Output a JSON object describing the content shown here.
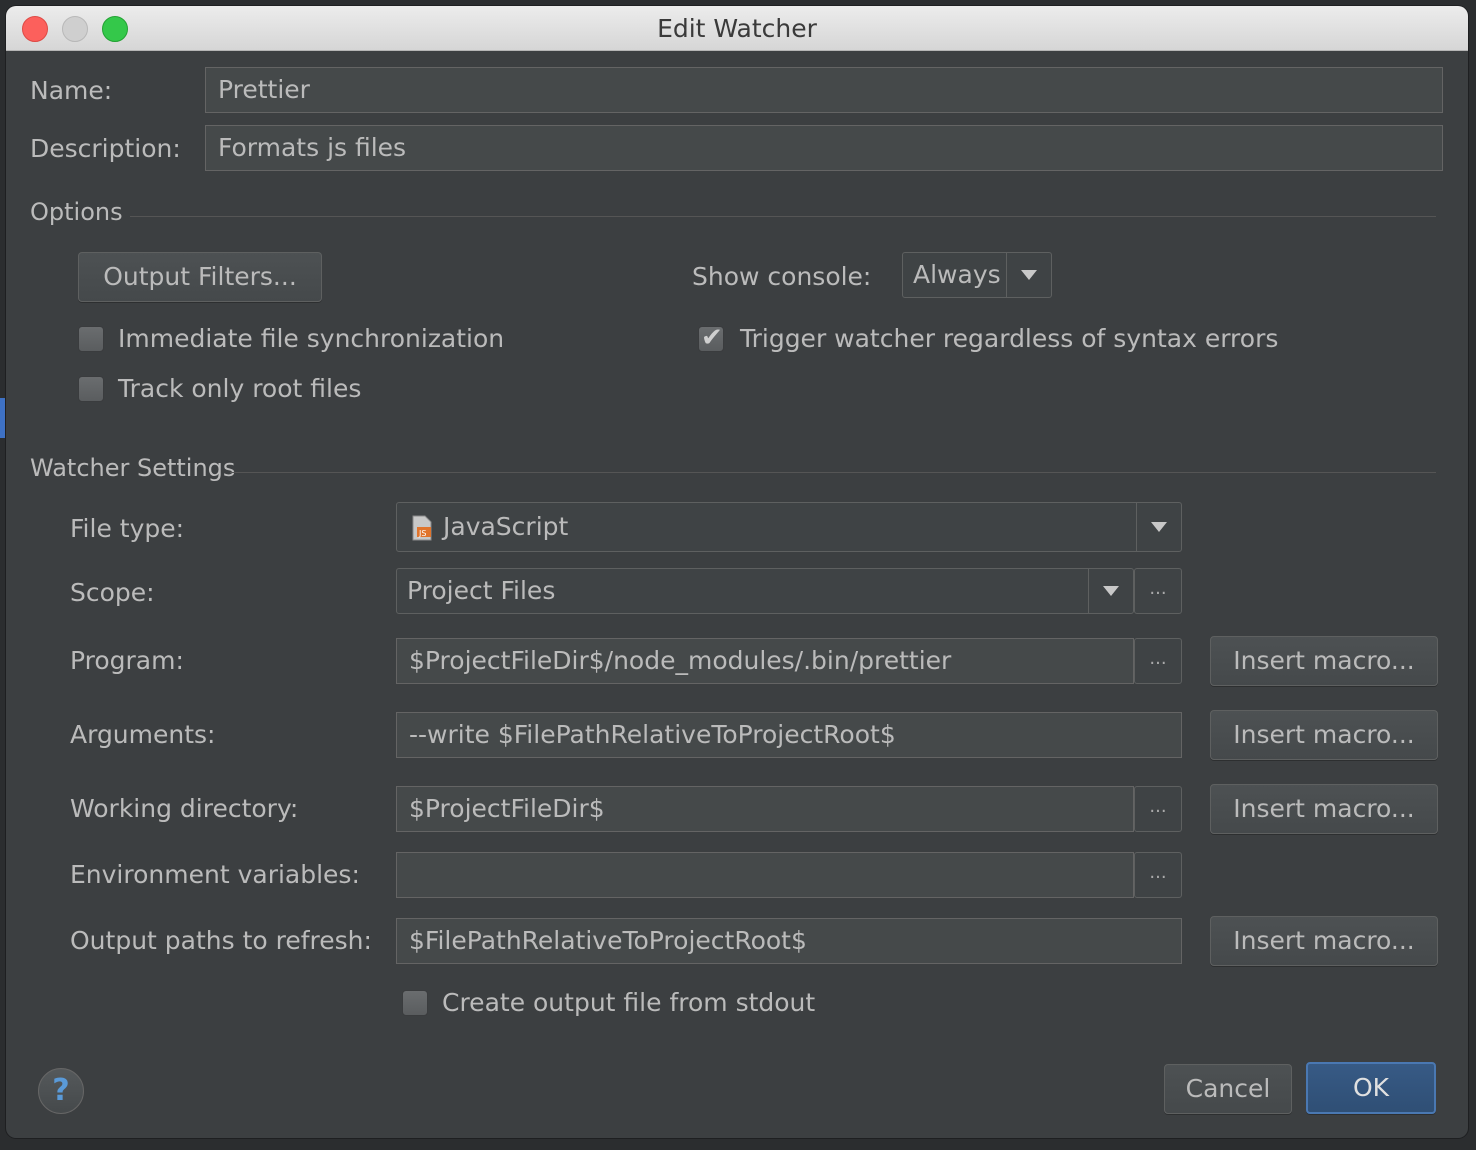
{
  "window": {
    "title": "Edit Watcher"
  },
  "name": {
    "label": "Name:",
    "value": "Prettier"
  },
  "description": {
    "label": "Description:",
    "value": "Formats js files"
  },
  "options": {
    "section_label": "Options",
    "output_filters_button": "Output Filters...",
    "show_console_label": "Show console:",
    "show_console_value": "Always",
    "immediate_sync": {
      "label": "Immediate file synchronization",
      "checked": false
    },
    "track_root": {
      "label": "Track only root files",
      "checked": false
    },
    "trigger_regardless": {
      "label": "Trigger watcher regardless of syntax errors",
      "checked": true
    }
  },
  "watcher": {
    "section_label": "Watcher Settings",
    "file_type": {
      "label": "File type:",
      "value": "JavaScript",
      "icon": "js-file-icon"
    },
    "scope": {
      "label": "Scope:",
      "value": "Project Files"
    },
    "program": {
      "label": "Program:",
      "value": "$ProjectFileDir$/node_modules/.bin/prettier"
    },
    "arguments": {
      "label": "Arguments:",
      "value": "--write $FilePathRelativeToProjectRoot$"
    },
    "working_dir": {
      "label": "Working directory:",
      "value": "$ProjectFileDir$"
    },
    "env_vars": {
      "label": "Environment variables:",
      "value": ""
    },
    "output_paths": {
      "label": "Output paths to refresh:",
      "value": "$FilePathRelativeToProjectRoot$"
    },
    "create_output": {
      "label": "Create output file from stdout",
      "checked": false
    },
    "insert_macro_label": "Insert macro...",
    "browse_label": "..."
  },
  "footer": {
    "help": "?",
    "cancel": "Cancel",
    "ok": "OK"
  },
  "colors": {
    "background": "#3c3f41",
    "field": "#45494a",
    "ok_button": "#375a85",
    "help_icon": "#5a9ad8"
  }
}
